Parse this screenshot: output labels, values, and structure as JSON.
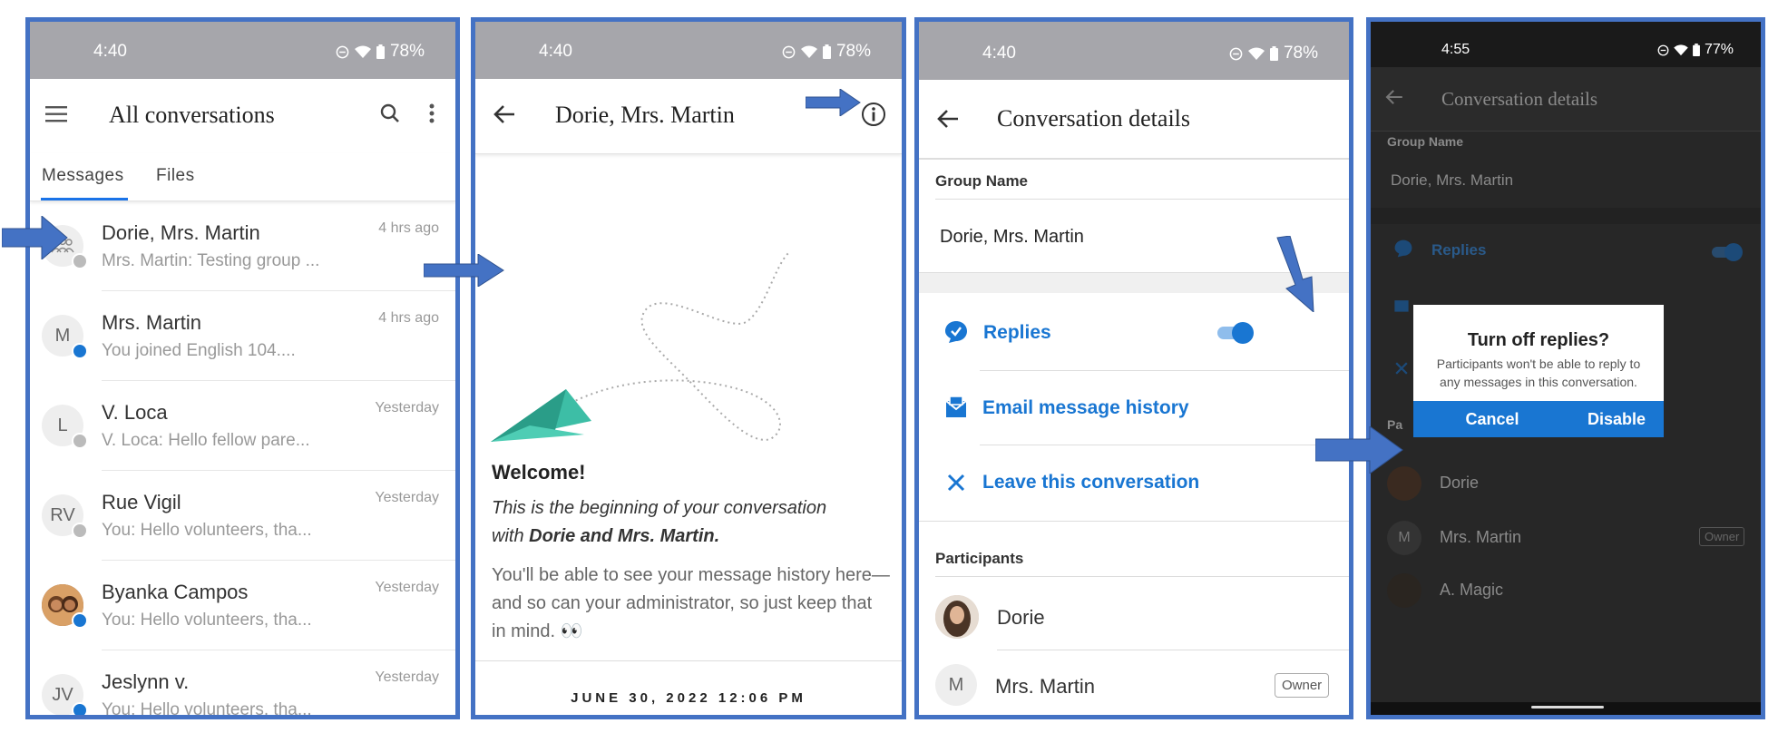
{
  "panel1": {
    "status": {
      "time": "4:40",
      "battery": "78%"
    },
    "title": "All conversations",
    "tabs": [
      "Messages",
      "Files"
    ],
    "conversations": [
      {
        "name": "Dorie, Mrs. Martin",
        "preview": "Mrs. Martin: Testing group ...",
        "time": "4 hrs ago",
        "avatar": "group-icon"
      },
      {
        "name": "Mrs. Martin",
        "preview": "You joined English 104....",
        "time": "4 hrs ago",
        "initials": "M"
      },
      {
        "name": "V. Loca",
        "preview": "V. Loca: Hello fellow pare...",
        "time": "Yesterday",
        "initials": "L"
      },
      {
        "name": "Rue Vigil",
        "preview": "You: Hello volunteers, tha...",
        "time": "Yesterday",
        "initials": "RV"
      },
      {
        "name": "Byanka Campos",
        "preview": "You: Hello volunteers, tha...",
        "time": "Yesterday",
        "avatar": "photo"
      },
      {
        "name": "Jeslynn v.",
        "preview": "You: Hello volunteers, tha...",
        "time": "Yesterday",
        "initials": "JV"
      }
    ]
  },
  "panel2": {
    "status": {
      "time": "4:40",
      "battery": "78%"
    },
    "title": "Dorie, Mrs. Martin",
    "welcome": "Welcome!",
    "intro_line1": "This is the beginning of your conversation",
    "intro_with": "with ",
    "intro_names": "Dorie and Mrs. Martin.",
    "body": "You'll be able to see your message history here—and so can your administrator, so just keep that in mind. 👀",
    "date": "JUNE 30, 2022 12:06 PM"
  },
  "panel3": {
    "status": {
      "time": "4:40",
      "battery": "78%"
    },
    "title": "Conversation details",
    "group_name_label": "Group Name",
    "group_name": "Dorie, Mrs. Martin",
    "replies": "Replies",
    "replies_on": true,
    "email_history": "Email message history",
    "leave": "Leave this conversation",
    "participants_label": "Participants",
    "participants": [
      {
        "name": "Dorie",
        "avatar": "photo"
      },
      {
        "name": "Mrs. Martin",
        "initials": "M",
        "role": "Owner"
      }
    ]
  },
  "panel4": {
    "status": {
      "time": "4:55",
      "battery": "77%"
    },
    "title": "Conversation details",
    "group_name_label": "Group Name",
    "group_name": "Dorie, Mrs. Martin",
    "replies": "Replies",
    "participants_label": "Pa",
    "participants": [
      {
        "name": "Dorie"
      },
      {
        "name": "Mrs. Martin",
        "initials": "M",
        "role": "Owner"
      },
      {
        "name": "A. Magic"
      }
    ],
    "dialog": {
      "title": "Turn off replies?",
      "message": "Participants won't be able to reply to any messages in this conversation.",
      "cancel": "Cancel",
      "disable": "Disable"
    }
  },
  "colors": {
    "frame": "#4472c4",
    "accent": "#1976d2",
    "arrow": "#4472c4"
  }
}
